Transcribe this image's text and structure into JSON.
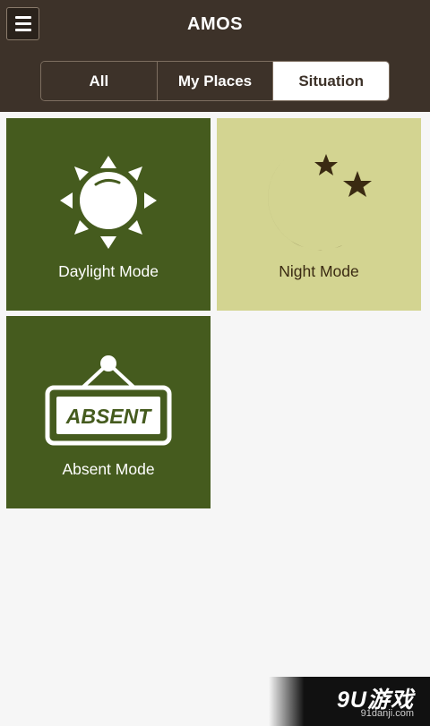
{
  "header": {
    "title": "AMOS",
    "menu_icon": "hamburger-menu-icon"
  },
  "tabs": [
    {
      "label": "All",
      "active": false
    },
    {
      "label": "My Places",
      "active": false
    },
    {
      "label": "Situation",
      "active": true
    }
  ],
  "tiles": [
    {
      "label": "Daylight Mode",
      "icon": "sun-icon",
      "color": "#455b1e"
    },
    {
      "label": "Night Mode",
      "icon": "moon-stars-icon",
      "color": "#d3d491"
    },
    {
      "label": "Absent Mode",
      "icon": "absent-sign-icon",
      "sign_text": "ABSENT",
      "color": "#455b1e"
    }
  ],
  "colors": {
    "header_bg": "#3d3229",
    "tile_dark": "#455b1e",
    "tile_light": "#d3d491",
    "background": "#f6f6f6"
  },
  "watermark": {
    "logo": "9U游戏",
    "url": "91danji.com"
  }
}
